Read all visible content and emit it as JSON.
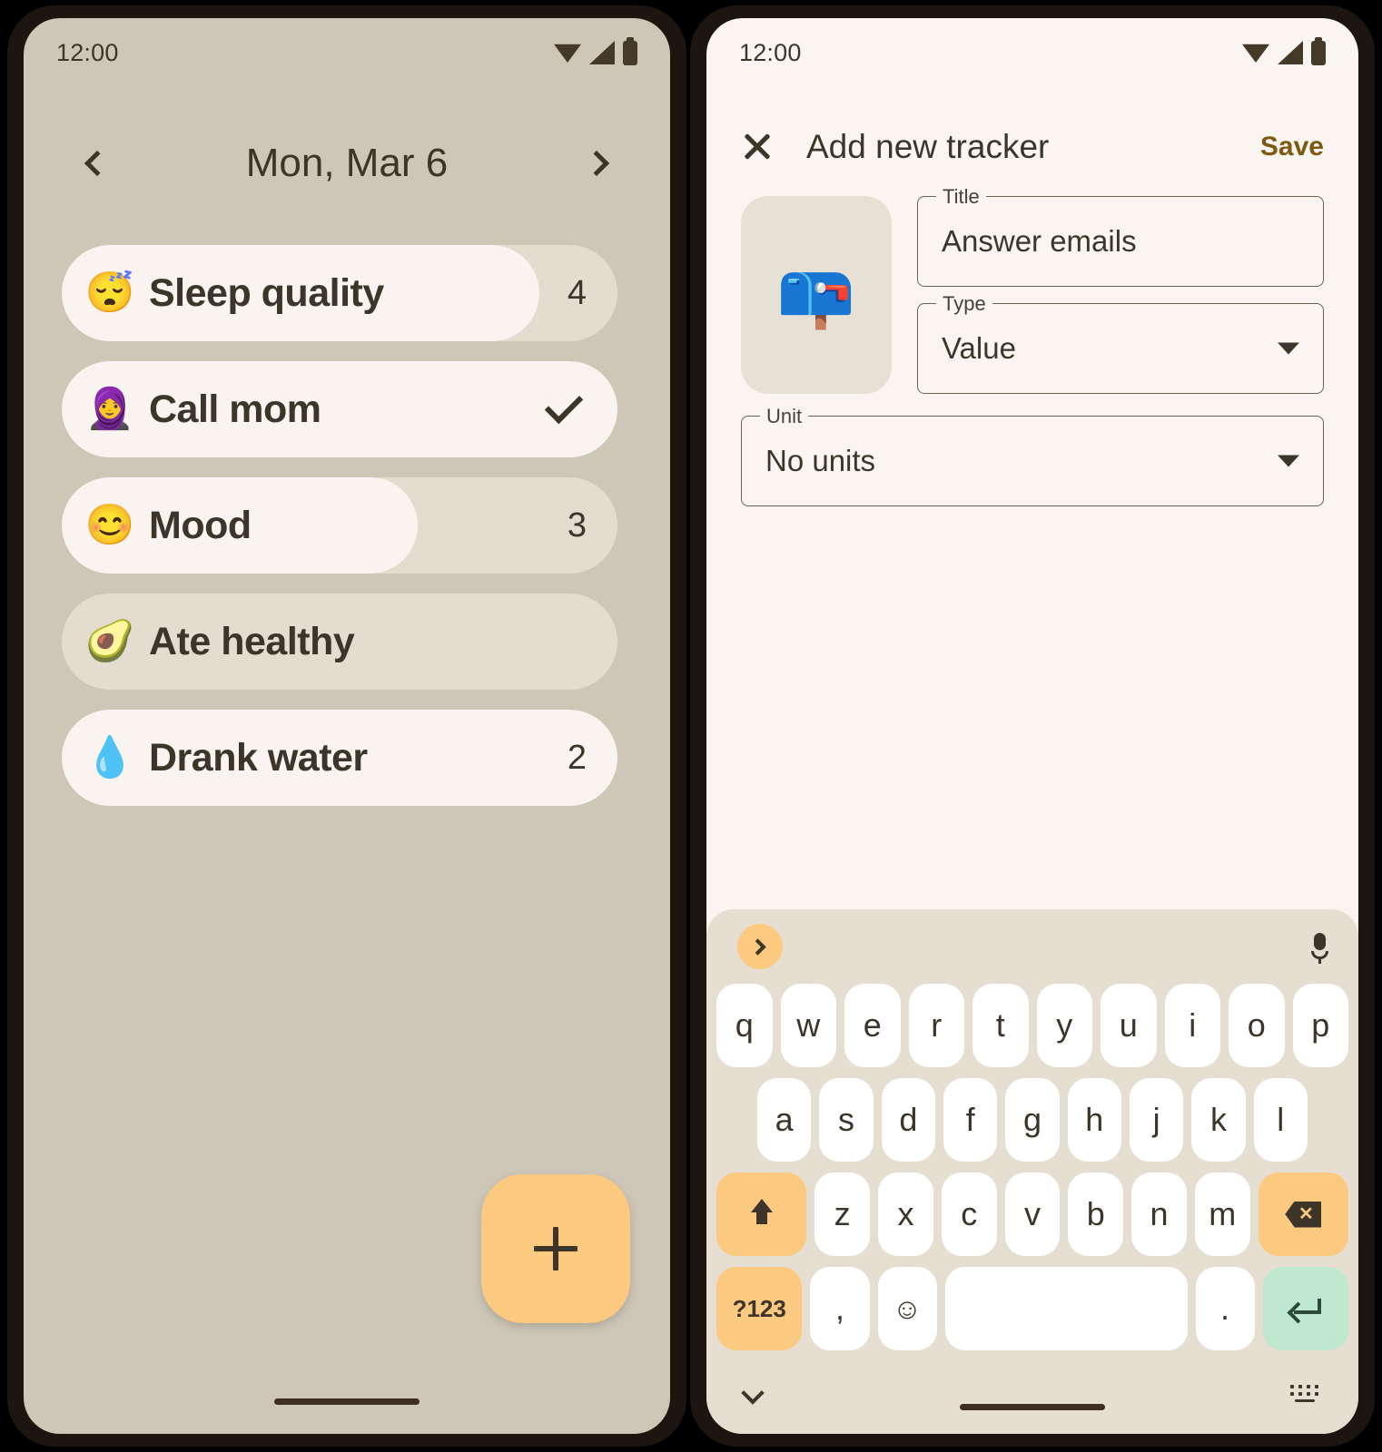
{
  "left_phone": {
    "status": {
      "time": "12:00",
      "icons": [
        "wifi-icon",
        "signal-icon",
        "battery-icon"
      ]
    },
    "header": {
      "prev_label": "chevron-left-icon",
      "title": "Mon, Mar 6",
      "next_label": "chevron-right-icon"
    },
    "trackers": [
      {
        "emoji": "😴",
        "emoji_name": "sleeping-face-emoji",
        "label": "Sleep quality",
        "value": "4",
        "fill_pct": 86,
        "type": "value"
      },
      {
        "emoji": "🧕",
        "emoji_name": "woman-with-headscarf-emoji",
        "label": "Call mom",
        "value": "✓",
        "fill_pct": 100,
        "type": "check"
      },
      {
        "emoji": "😊",
        "emoji_name": "smiling-face-emoji",
        "label": "Mood",
        "value": "3",
        "fill_pct": 64,
        "type": "value"
      },
      {
        "emoji": "🥑",
        "emoji_name": "avocado-emoji",
        "label": "Ate healthy",
        "value": "",
        "fill_pct": 0,
        "type": "empty"
      },
      {
        "emoji": "💧",
        "emoji_name": "droplet-emoji",
        "label": "Drank water",
        "value": "2",
        "fill_pct": 100,
        "type": "value"
      }
    ],
    "fab": {
      "label": "+",
      "icon": "plus-icon"
    }
  },
  "right_phone": {
    "status": {
      "time": "12:00",
      "icons": [
        "wifi-icon",
        "signal-icon",
        "battery-icon"
      ]
    },
    "appbar": {
      "close_icon": "close-icon",
      "title": "Add new tracker",
      "save_label": "Save"
    },
    "form": {
      "emoji": "📪",
      "emoji_name": "closed-mailbox-with-raised-flag-emoji",
      "title_field": {
        "label": "Title",
        "value": "Answer emails"
      },
      "type_field": {
        "label": "Type",
        "value": "Value",
        "options": [
          "Value"
        ]
      },
      "unit_field": {
        "label": "Unit",
        "value": "No units",
        "options": [
          "No units"
        ]
      }
    },
    "keyboard": {
      "expand_icon": "chevron-right-icon",
      "mic_icon": "microphone-icon",
      "row1": [
        "q",
        "w",
        "e",
        "r",
        "t",
        "y",
        "u",
        "i",
        "o",
        "p"
      ],
      "row2": [
        "a",
        "s",
        "d",
        "f",
        "g",
        "h",
        "j",
        "k",
        "l"
      ],
      "row3_shift": "shift-icon",
      "row3": [
        "z",
        "x",
        "c",
        "v",
        "b",
        "n",
        "m"
      ],
      "row3_backspace": "backspace-icon",
      "row4_symbols": "?123",
      "row4_comma": ",",
      "row4_emoji": "emoji-icon",
      "row4_space": "",
      "row4_period": ".",
      "row4_enter": "enter-icon",
      "hide_icon": "chevron-down-icon",
      "switch_icon": "keyboard-switch-icon"
    }
  },
  "colors": {
    "left_bg": "#CEC7B7",
    "right_bg": "#FBF5F1",
    "accent_orange": "#FBC97F",
    "enter_green": "#BFE8CE",
    "text_dark": "#3E352A",
    "save_amber": "#7C5A12",
    "track": "#E3DCCF",
    "fill": "#FAF4F0",
    "keyboard_bg": "#E7DED2"
  }
}
